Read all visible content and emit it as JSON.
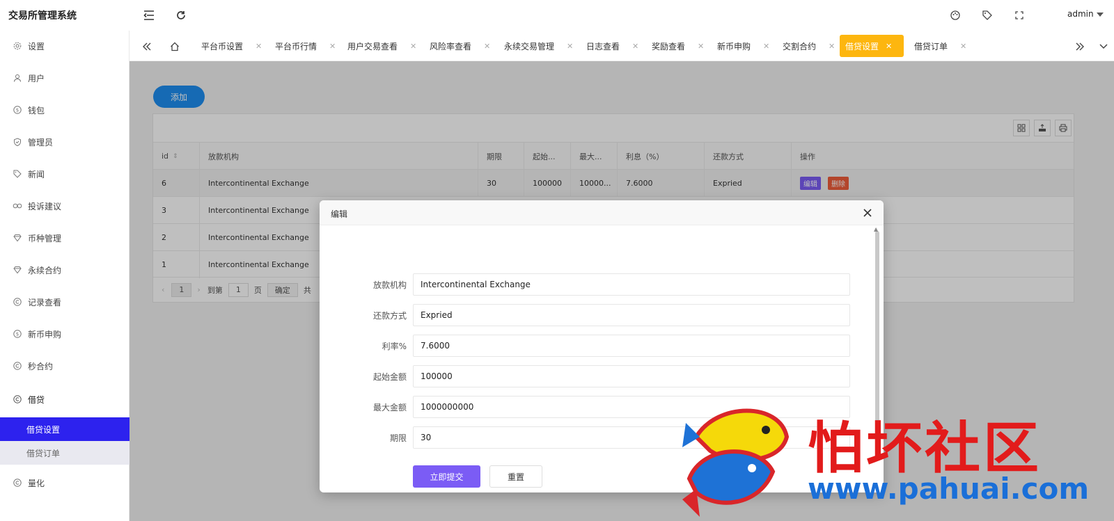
{
  "app": {
    "title": "交易所管理系统",
    "user": "admin"
  },
  "sidebar": {
    "items": [
      {
        "label": "设置",
        "icon": "gear-icon"
      },
      {
        "label": "用户",
        "icon": "user-icon"
      },
      {
        "label": "钱包",
        "icon": "dollar-icon"
      },
      {
        "label": "管理员",
        "icon": "shield-icon"
      },
      {
        "label": "新闻",
        "icon": "tag-icon"
      },
      {
        "label": "投诉建议",
        "icon": "link-icon"
      },
      {
        "label": "币种管理",
        "icon": "diamond-icon"
      },
      {
        "label": "永续合约",
        "icon": "diamond-icon"
      },
      {
        "label": "记录查看",
        "icon": "circle-c-icon"
      },
      {
        "label": "新币申购",
        "icon": "dollar-icon"
      },
      {
        "label": "秒合约",
        "icon": "circle-c-icon"
      },
      {
        "label": "借贷",
        "icon": "circle-c-icon"
      },
      {
        "label": "量化",
        "icon": "circle-c-icon"
      }
    ],
    "sub": [
      {
        "label": "借贷设置",
        "active": true
      },
      {
        "label": "借贷订单",
        "active": false
      }
    ]
  },
  "tabs": [
    {
      "label": "平台币设置"
    },
    {
      "label": "平台币行情"
    },
    {
      "label": "用户交易查看"
    },
    {
      "label": "风险率查看"
    },
    {
      "label": "永续交易管理"
    },
    {
      "label": "日志查看"
    },
    {
      "label": "奖励查看"
    },
    {
      "label": "新币申购"
    },
    {
      "label": "交割合约"
    },
    {
      "label": "借贷设置",
      "active": true
    },
    {
      "label": "借贷订单"
    }
  ],
  "main": {
    "add_label": "添加",
    "columns": [
      "id",
      "放款机构",
      "期限",
      "起始...",
      "最大...",
      "利息（%）",
      "还款方式",
      "操作"
    ],
    "rows": [
      {
        "id": "6",
        "org": "Intercontinental Exchange",
        "term": "30",
        "start": "100000",
        "max": "10000...",
        "rate": "7.6000",
        "repay": "Expried"
      },
      {
        "id": "3",
        "org": "Intercontinental Exchange"
      },
      {
        "id": "2",
        "org": "Intercontinental Exchange"
      },
      {
        "id": "1",
        "org": "Intercontinental Exchange"
      }
    ],
    "edit_label": "编辑",
    "delete_label": "删除",
    "pager": {
      "page": "1",
      "goto_label": "到第",
      "goto_value": "1",
      "page_unit": "页",
      "confirm_label": "确定",
      "total_prefix": "共"
    }
  },
  "modal": {
    "title": "编辑",
    "fields": [
      {
        "label": "放款机构",
        "value": "Intercontinental Exchange"
      },
      {
        "label": "还款方式",
        "value": "Expried"
      },
      {
        "label": "利率%",
        "value": "7.6000"
      },
      {
        "label": "起始金额",
        "value": "100000"
      },
      {
        "label": "最大金额",
        "value": "1000000000"
      },
      {
        "label": "期限",
        "value": "30"
      }
    ],
    "submit_label": "立即提交",
    "reset_label": "重置"
  },
  "watermark": {
    "text": "怕坏社区",
    "url": "www.pahuai.com"
  },
  "colors": {
    "sidebar_active": "#2d22ee",
    "tab_active": "#fdb60f",
    "primary": "#1e8ef0",
    "purple": "#7b5cf5",
    "danger": "#ef5c3a"
  }
}
